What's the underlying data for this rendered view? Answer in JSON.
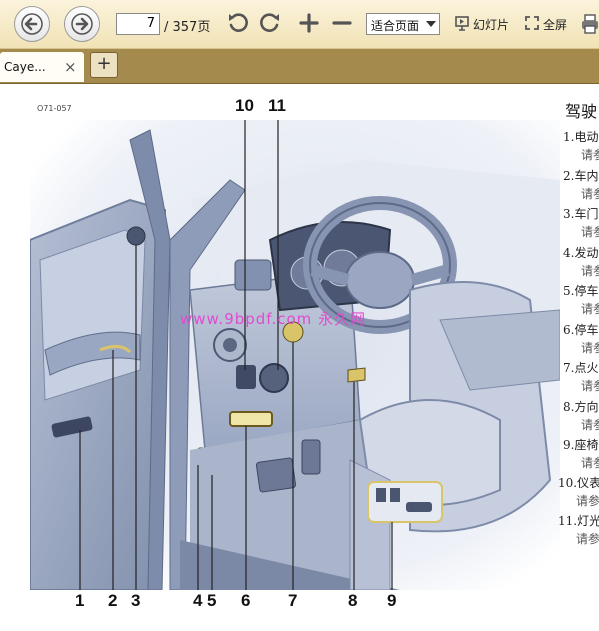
{
  "toolbar": {
    "current_page": "7",
    "page_total": "/ 357页",
    "zoom_select": "适合页面",
    "slideshow_label": "幻灯片",
    "fullscreen_label": "全屏"
  },
  "tabs": [
    {
      "label": "Caye...",
      "close": "×"
    }
  ],
  "new_tab_label": "+",
  "document": {
    "figure_code": "O71-057",
    "watermark": "www.9bpdf.com 永久网",
    "callouts_top": [
      "10",
      "11"
    ],
    "callouts_bottom": [
      "1",
      "2",
      "3",
      "4",
      "5",
      "6",
      "7",
      "8",
      "9"
    ],
    "section_title": "驾驶",
    "list": [
      {
        "num": "1.",
        "text": "电动",
        "sub": "请参"
      },
      {
        "num": "2.",
        "text": "车内",
        "sub": "请参"
      },
      {
        "num": "3.",
        "text": "车门",
        "sub": "请参"
      },
      {
        "num": "4.",
        "text": "发动",
        "sub": "请参"
      },
      {
        "num": "5.",
        "text": "停车",
        "sub": "请参"
      },
      {
        "num": "6.",
        "text": "停车",
        "sub": "请参"
      },
      {
        "num": "7.",
        "text": "点火",
        "sub": "请参"
      },
      {
        "num": "8.",
        "text": "方向",
        "sub": "请参"
      },
      {
        "num": "9.",
        "text": "座椅",
        "sub": "请参"
      },
      {
        "num": "10.",
        "text": "仪表",
        "sub": "请参"
      },
      {
        "num": "11.",
        "text": "灯光",
        "sub": "请参"
      }
    ]
  }
}
